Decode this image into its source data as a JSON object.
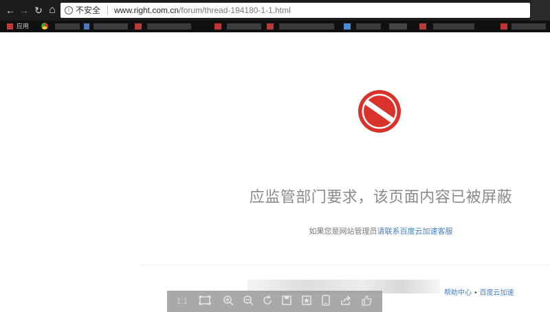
{
  "browser": {
    "nav": {
      "back_icon": "arrow-left-icon",
      "forward_icon": "arrow-right-icon",
      "reload_icon": "reload-icon",
      "home_icon": "home-icon",
      "back_glyph": "←",
      "forward_glyph": "→",
      "reload_glyph": "↻",
      "home_glyph": "⌂"
    },
    "address_bar": {
      "security_label": "不安全",
      "url_host": "www.right.com.cn",
      "url_path": "/forum/thread-194180-1-1.html"
    },
    "bookmarks": {
      "apps_label": "应用"
    }
  },
  "page": {
    "headline": "应监管部门要求，该页面内容已被屏蔽",
    "subline_prefix": "如果您是网站管理员",
    "subline_link": "请联系百度云加速客服",
    "footer_links": [
      "帮助中心",
      "百度云加速"
    ],
    "footer_separator": "•",
    "block_icon": "prohibited-icon",
    "block_color": "#d9322b"
  },
  "viewer_toolbar": {
    "ratio_label": "1:1",
    "icons": [
      "fit-screen-icon",
      "zoom-in-icon",
      "zoom-out-icon",
      "rotate-icon",
      "save-icon",
      "bookmark-icon",
      "phone-icon",
      "share-icon",
      "like-icon"
    ]
  }
}
